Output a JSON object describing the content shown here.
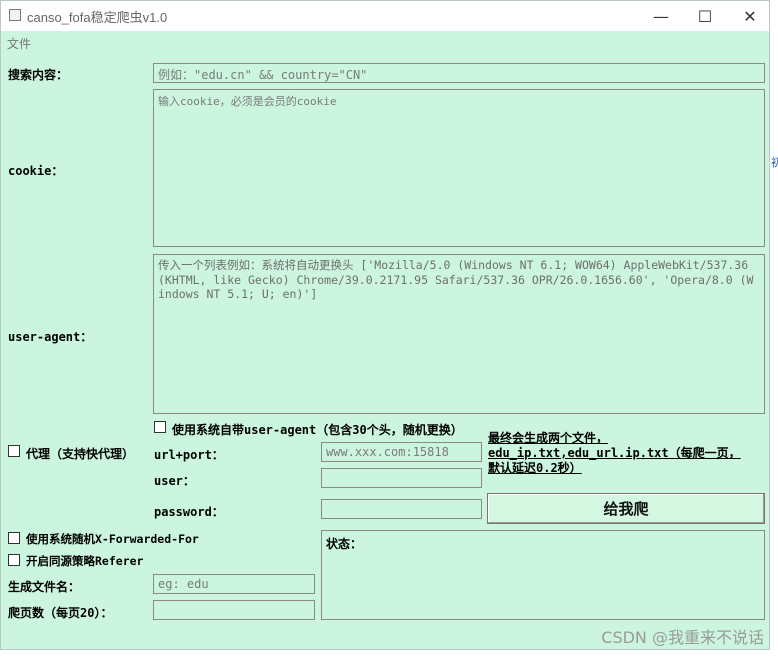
{
  "window": {
    "title": "canso_fofa稳定爬虫v1.0",
    "minimize": "—",
    "maximize": "☐",
    "close": "✕"
  },
  "menu": {
    "file": "文件"
  },
  "labels": {
    "search": "搜索内容：",
    "cookie": "cookie：",
    "user_agent": "user-agent：",
    "proxy": "代理（支持快代理）",
    "url_port": "url+port：",
    "user": "user：",
    "password": "password：",
    "xff": "使用系统随机X-Forwarded-For",
    "referer": "开启同源策略Referer",
    "filename": "生成文件名：",
    "pages": "爬页数（每页20）：",
    "sys_ua": "使用系统自带user-agent（包含30个头，随机更换）",
    "status": "状态："
  },
  "fields": {
    "search_placeholder": "例如：\"edu.cn\" && country=\"CN\"",
    "cookie_placeholder": "输入cookie，必须是会员的cookie",
    "ua_placeholder": "传入一个列表例如：系统将自动更换头 ['Mozilla/5.0 (Windows NT 6.1; WOW64) AppleWebKit/537.36 (KHTML, like Gecko) Chrome/39.0.2171.95 Safari/537.36 OPR/26.0.1656.60', 'Opera/8.0 (Windows NT 5.1; U; en)']",
    "url_port_placeholder": "www.xxx.com:15818",
    "user_value": "",
    "password_value": "",
    "filename_placeholder": "eg: edu",
    "pages_value": ""
  },
  "info_text": "最终会生成两个文件，edu_ip.txt,edu_url.ip.txt（每爬一页，默认延迟0.2秒）",
  "run_button": "给我爬",
  "watermark": "CSDN @我重来不说话",
  "edge_glyph": "初"
}
